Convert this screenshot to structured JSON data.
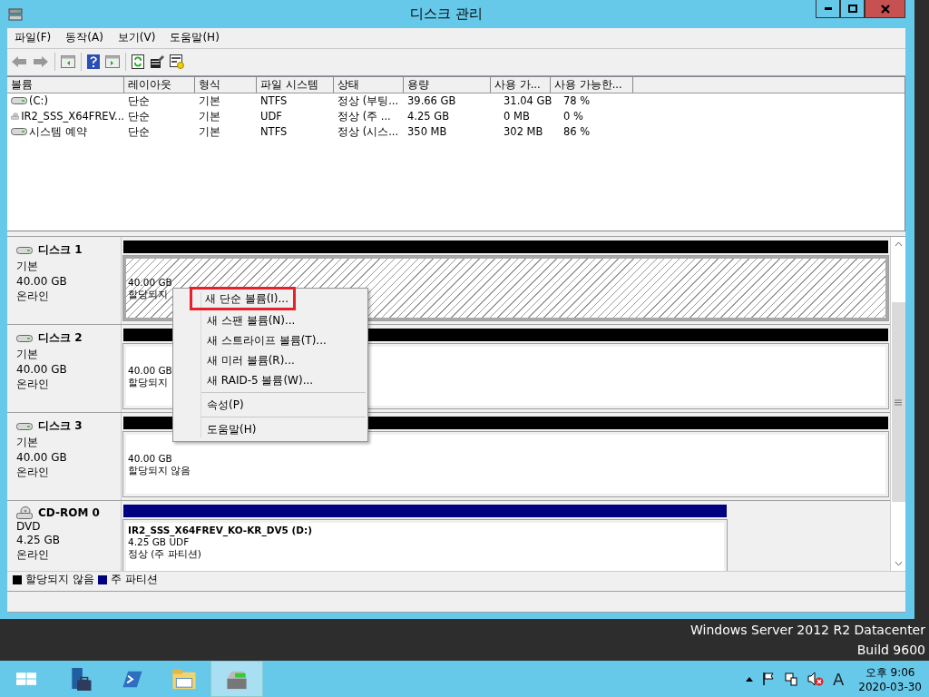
{
  "window": {
    "title": "디스크 관리"
  },
  "menu": [
    "파일(F)",
    "동작(A)",
    "보기(V)",
    "도움말(H)"
  ],
  "volumes": {
    "columns": [
      "볼륨",
      "레이아웃",
      "형식",
      "파일 시스템",
      "상태",
      "용량",
      "사용 가...",
      "사용 가능한..."
    ],
    "rows": [
      {
        "kind": "disk",
        "cells": [
          "(C:)",
          "단순",
          "기본",
          "NTFS",
          "정상 (부팅...",
          "39.66 GB",
          "31.04 GB",
          "78 %"
        ]
      },
      {
        "kind": "cd",
        "cells": [
          "IR2_SSS_X64FREV...",
          "단순",
          "기본",
          "UDF",
          "정상 (주 ...",
          "4.25 GB",
          "0 MB",
          "0 %"
        ]
      },
      {
        "kind": "disk",
        "cells": [
          "시스템 예약",
          "단순",
          "기본",
          "NTFS",
          "정상 (시스...",
          "350 MB",
          "302 MB",
          "86 %"
        ]
      }
    ]
  },
  "disks": [
    {
      "kind": "disk",
      "name": "디스크 1",
      "type": "기본",
      "size": "40.00 GB",
      "status": "온라인",
      "partition": {
        "kind": "unallocated",
        "selected": true,
        "size": "40.00 GB",
        "status": "할당되지"
      }
    },
    {
      "kind": "disk",
      "name": "디스크 2",
      "type": "기본",
      "size": "40.00 GB",
      "status": "온라인",
      "partition": {
        "kind": "unallocated",
        "selected": false,
        "size": "40.00 GB",
        "status": "할당되지"
      }
    },
    {
      "kind": "disk",
      "name": "디스크 3",
      "type": "기본",
      "size": "40.00 GB",
      "status": "온라인",
      "partition": {
        "kind": "unallocated",
        "selected": false,
        "size": "40.00 GB",
        "status": "할당되지 않음"
      }
    },
    {
      "kind": "cd",
      "name": "CD-ROM 0",
      "type": "DVD",
      "size": "4.25 GB",
      "status": "온라인",
      "partition": {
        "kind": "primary",
        "selected": false,
        "name": "IR2_SSS_X64FREV_KO-KR_DV5  (D:)",
        "size": "4.25 GB UDF",
        "status": "정상 (주 파티션)"
      }
    }
  ],
  "legend": [
    {
      "label": "할당되지 않음",
      "color": "#000000"
    },
    {
      "label": "주 파티션",
      "color": "#000080"
    }
  ],
  "context_menu": [
    [
      {
        "label": "새 단순 볼륨(I)...",
        "highlighted": true
      },
      {
        "label": "새 스팬 볼륨(N)...",
        "highlighted": false
      },
      {
        "label": "새 스트라이프 볼륨(T)...",
        "highlighted": false
      },
      {
        "label": "새 미러 볼륨(R)...",
        "highlighted": false
      },
      {
        "label": "새 RAID-5 볼륨(W)...",
        "highlighted": false
      }
    ],
    [
      {
        "label": "속성(P)",
        "highlighted": false
      }
    ],
    [
      {
        "label": "도움말(H)",
        "highlighted": false
      }
    ]
  ],
  "desktop": [
    "Windows Server 2012 R2 Datacenter",
    "Build 9600"
  ],
  "taskbar": {
    "apps": [
      {
        "selected": false
      },
      {
        "selected": false
      },
      {
        "selected": false
      },
      {
        "selected": false
      },
      {
        "selected": true
      }
    ],
    "tray_input": "A",
    "time": "오후 9:06",
    "date": "2020-03-30"
  }
}
